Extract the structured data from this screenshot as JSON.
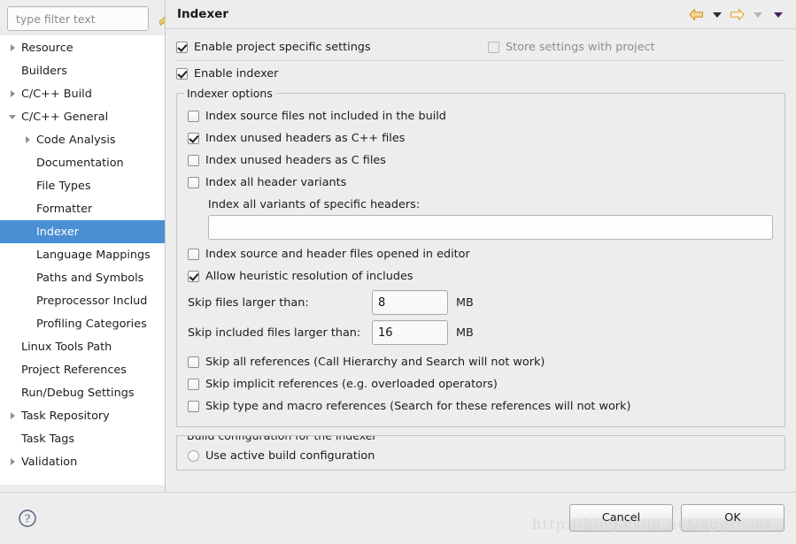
{
  "window": {
    "page_title": "Indexer"
  },
  "sidebar": {
    "filter_placeholder": "type filter text",
    "filter_value": "",
    "clear_icon": "broom-icon",
    "items": [
      {
        "label": "Resource",
        "indent": 0,
        "twisty": "collapsed",
        "selected": false
      },
      {
        "label": "Builders",
        "indent": 0,
        "twisty": "none",
        "selected": false
      },
      {
        "label": "C/C++ Build",
        "indent": 0,
        "twisty": "collapsed",
        "selected": false
      },
      {
        "label": "C/C++ General",
        "indent": 0,
        "twisty": "expanded",
        "selected": false
      },
      {
        "label": "Code Analysis",
        "indent": 1,
        "twisty": "collapsed",
        "selected": false
      },
      {
        "label": "Documentation",
        "indent": 1,
        "twisty": "none",
        "selected": false
      },
      {
        "label": "File Types",
        "indent": 1,
        "twisty": "none",
        "selected": false
      },
      {
        "label": "Formatter",
        "indent": 1,
        "twisty": "none",
        "selected": false
      },
      {
        "label": "Indexer",
        "indent": 1,
        "twisty": "none",
        "selected": true
      },
      {
        "label": "Language Mappings",
        "indent": 1,
        "twisty": "none",
        "selected": false
      },
      {
        "label": "Paths and Symbols",
        "indent": 1,
        "twisty": "none",
        "selected": false
      },
      {
        "label": "Preprocessor Includ",
        "indent": 1,
        "twisty": "none",
        "selected": false
      },
      {
        "label": "Profiling Categories",
        "indent": 1,
        "twisty": "none",
        "selected": false
      },
      {
        "label": "Linux Tools Path",
        "indent": 0,
        "twisty": "none",
        "selected": false
      },
      {
        "label": "Project References",
        "indent": 0,
        "twisty": "none",
        "selected": false
      },
      {
        "label": "Run/Debug Settings",
        "indent": 0,
        "twisty": "none",
        "selected": false
      },
      {
        "label": "Task Repository",
        "indent": 0,
        "twisty": "collapsed",
        "selected": false
      },
      {
        "label": "Task Tags",
        "indent": 0,
        "twisty": "none",
        "selected": false
      },
      {
        "label": "Validation",
        "indent": 0,
        "twisty": "collapsed",
        "selected": false
      },
      {
        "label": "",
        "indent": 0,
        "twisty": "none",
        "selected": false
      }
    ]
  },
  "header": {
    "title": "Indexer",
    "nav": [
      {
        "name": "back-arrow-icon",
        "kind": "arrow-left",
        "state": "enabled"
      },
      {
        "name": "back-dropdown-icon",
        "kind": "caret",
        "state": "enabled"
      },
      {
        "name": "forward-arrow-icon",
        "kind": "arrow-right",
        "state": "enabled"
      },
      {
        "name": "forward-dropdown-icon",
        "kind": "caret",
        "state": "disabled"
      },
      {
        "name": "view-menu-dropdown-icon",
        "kind": "caret",
        "state": "purple"
      }
    ]
  },
  "main": {
    "enable_project_specific": {
      "label": "Enable project specific settings",
      "checked": true,
      "enabled": true
    },
    "store_settings_with_project": {
      "label": "Store settings with project",
      "checked": false,
      "enabled": false
    },
    "enable_indexer": {
      "label": "Enable indexer",
      "checked": true,
      "enabled": true
    },
    "indexer_options": {
      "group_title": "Indexer options",
      "checkboxes": [
        {
          "label": "Index source files not included in the build",
          "checked": false
        },
        {
          "label": "Index unused headers as C++ files",
          "checked": true
        },
        {
          "label": "Index unused headers as C files",
          "checked": false
        },
        {
          "label": "Index all header variants",
          "checked": false
        }
      ],
      "specific_headers_label": "Index all variants of specific headers:",
      "specific_headers_value": "",
      "checkboxes_2": [
        {
          "label": "Index source and header files opened in editor",
          "checked": false
        },
        {
          "label": "Allow heuristic resolution of includes",
          "checked": true
        }
      ],
      "skip_files": {
        "label": "Skip files larger than:",
        "value": "8",
        "unit": "MB"
      },
      "skip_included_files": {
        "label": "Skip included files larger than:",
        "value": "16",
        "unit": "MB"
      },
      "checkboxes_3": [
        {
          "label": "Skip all references (Call Hierarchy and Search will not work)",
          "checked": false
        },
        {
          "label": "Skip implicit references (e.g. overloaded operators)",
          "checked": false
        },
        {
          "label": "Skip type and macro references (Search for these references will not work)",
          "checked": false
        }
      ]
    },
    "build_configuration": {
      "group_title": "Build configuration for the indexer",
      "options": [
        {
          "label": "Use active build configuration",
          "selected": false
        }
      ]
    }
  },
  "footer": {
    "help_icon": "question-mark-icon",
    "cancel_label": "Cancel",
    "ok_label": "OK"
  },
  "watermark": {
    "text": "http://blog.csdn.net/aggresss"
  },
  "colors": {
    "selection_blue": "#4a8fd4",
    "panel_bg": "#ededed",
    "tree_bg": "#ffffff",
    "arrow_gold": "#e8a33d",
    "caret_purple": "#46205e"
  }
}
